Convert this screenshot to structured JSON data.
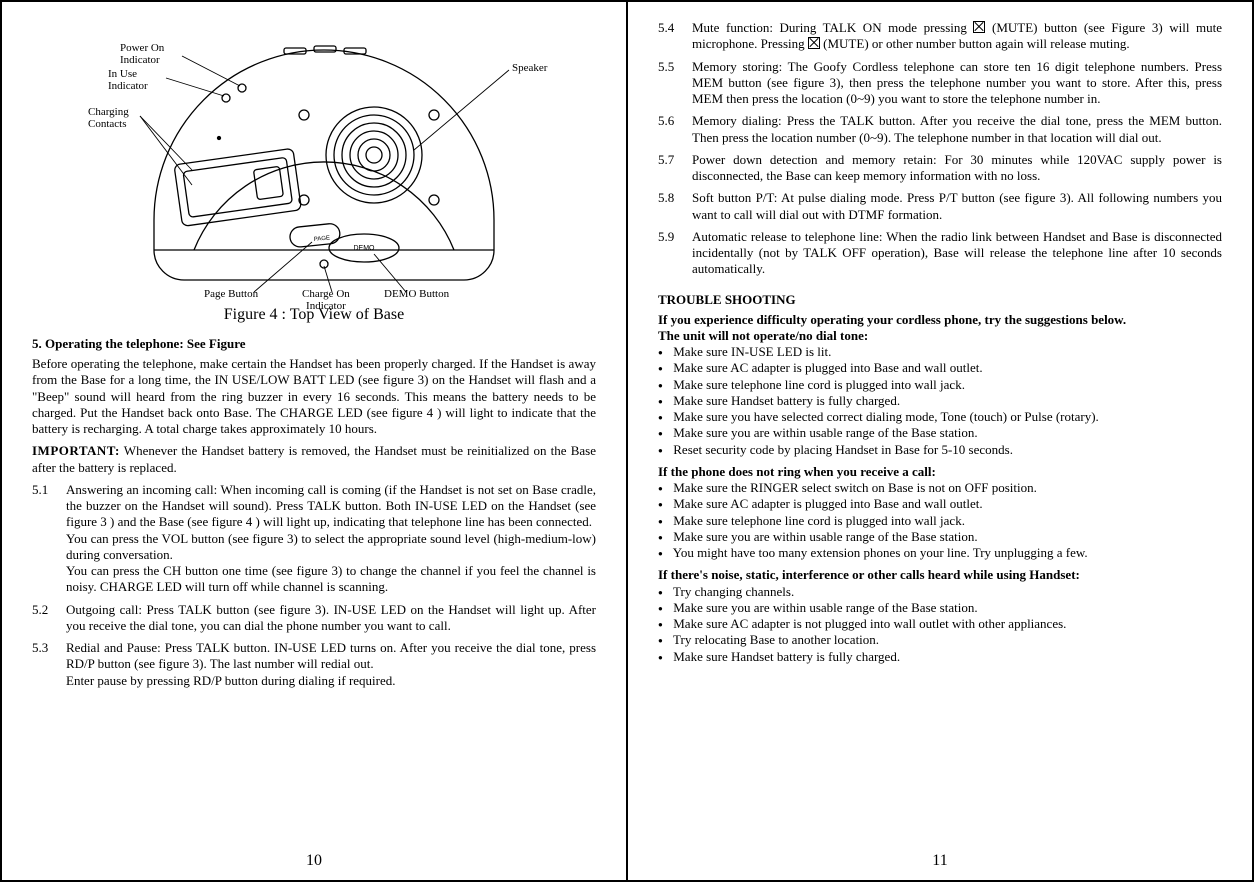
{
  "figure": {
    "caption": "Figure 4 : Top View of Base",
    "labels": {
      "power_on": "Power On\nIndicator",
      "in_use": "In Use\nIndicator",
      "charging": "Charging\nContacts",
      "speaker": "Speaker",
      "page_btn": "Page Button",
      "charge_on": "Charge On\nIndicator",
      "demo_btn": "DEMO Button",
      "page_text": "PAGE",
      "demo_text": "DEMO"
    }
  },
  "left": {
    "section_title": "5. Operating the telephone: See Figure",
    "intro": "Before operating the telephone, make certain the Handset has been properly charged. If the Handset is away from the Base for a long time, the IN USE/LOW BATT LED (see figure 3) on the Handset will flash and a \"Beep\" sound will heard from the ring buzzer in every 16 seconds. This means the battery needs to be charged. Put the Handset back onto Base. The CHARGE LED (see figure 4 ) will light to indicate that the battery is recharging. A total charge takes approximately 10 hours.",
    "important_label": "IMPORTANT:",
    "important_body": " Whenever the Handset battery is removed, the Handset must be reinitialized on the Base after the battery is replaced.",
    "items": [
      {
        "num": "5.1",
        "text": "Answering an incoming call: When incoming call is coming (if the Handset is not set on Base cradle, the buzzer on the Handset will sound). Press TALK button. Both IN-USE LED on the Handset (see figure 3 ) and the Base (see figure 4 ) will light up, indicating that telephone line has been connected.\nYou can press the VOL button (see figure 3) to select the appropriate sound level (high-medium-low) during conversation.\nYou can press the CH button one time (see figure 3) to change the channel if you feel the channel is noisy. CHARGE LED will turn off while channel is scanning."
      },
      {
        "num": "5.2",
        "text": "Outgoing call: Press TALK button (see figure 3). IN-USE LED on the Handset will light up. After you receive the dial tone, you can dial the phone number you want to call."
      },
      {
        "num": "5.3",
        "text": "Redial and Pause: Press TALK button. IN-USE LED turns on. After you receive the dial tone, press RD/P button (see figure 3). The last number will redial out.\nEnter pause by pressing RD/P button during dialing if required."
      }
    ],
    "page": "10"
  },
  "right": {
    "items": [
      {
        "num": "5.4",
        "pre": "Mute function: During TALK ON mode pressing ",
        "mid": " (MUTE) button (see Figure 3) will mute microphone. Pressing ",
        "post": " (MUTE) or other number button again will release muting."
      },
      {
        "num": "5.5",
        "text": "Memory storing:  The Goofy Cordless telephone can store ten 16 digit telephone numbers. Press MEM button (see figure 3), then press the telephone number you want to store. After this, press MEM then press the location (0~9) you want to store the telephone number in."
      },
      {
        "num": "5.6",
        "text": "Memory dialing:  Press the TALK button.  After you receive the dial tone, press the MEM button. Then press the location number (0~9). The telephone number in that location will dial out."
      },
      {
        "num": "5.7",
        "text": "Power down detection and memory retain:  For 30 minutes while 120VAC supply power is disconnected, the Base can keep memory information with no loss."
      },
      {
        "num": "5.8",
        "text": "Soft button P/T:  At pulse dialing mode. Press P/T button (see figure 3). All following numbers you want to call will dial out with DTMF formation."
      },
      {
        "num": "5.9",
        "text": "Automatic release to telephone line: When the radio link between Handset and Base  is disconnected incidentally (not by TALK OFF operation), Base  will release the telephone line after 10 seconds automatically."
      }
    ],
    "trouble_title": "TROUBLE SHOOTING",
    "trouble_intro": "If you experience difficulty operating your cordless phone, try the suggestions below.",
    "block1_title": "The unit will not operate/no dial tone:",
    "block1": [
      "Make sure IN-USE LED is lit.",
      "Make sure AC adapter is plugged into Base  and wall outlet.",
      "Make sure telephone line cord is plugged into wall jack.",
      "Make sure Handset battery is fully charged.",
      "Make sure you have selected correct dialing mode, Tone (touch) or Pulse (rotary).",
      "Make sure you are within usable range of the Base station.",
      "Reset security code by placing Handset in Base for 5-10 seconds."
    ],
    "block2_title": "If the phone does not ring when you receive a call:",
    "block2": [
      "Make sure the RINGER select switch on Base is not on OFF position.",
      "Make sure AC adapter is plugged into Base  and wall outlet.",
      "Make sure telephone line cord is plugged into wall jack.",
      "Make sure you are within usable range of the Base station.",
      "You might have too many extension phones on your line. Try unplugging a few."
    ],
    "block3_title": "If there's noise, static, interference or other calls heard while using Handset:",
    "block3": [
      "Try changing channels.",
      "Make sure you are within usable range of the Base station.",
      "Make sure AC adapter is not plugged into wall outlet with other appliances.",
      "Try relocating Base  to another location.",
      "Make sure Handset battery is fully charged."
    ],
    "page": "11"
  }
}
